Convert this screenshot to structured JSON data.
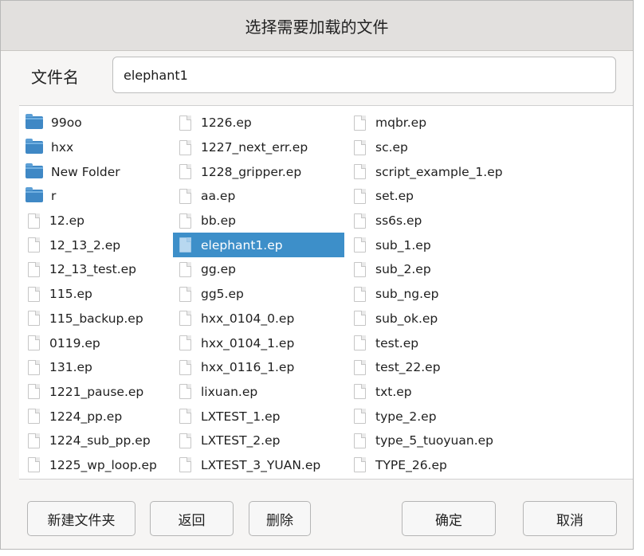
{
  "dialog": {
    "title": "选择需要加载的文件",
    "name_label": "文件名",
    "name_value": "elephant1"
  },
  "files": {
    "column1": [
      {
        "name": "99oo",
        "type": "folder"
      },
      {
        "name": "hxx",
        "type": "folder"
      },
      {
        "name": "New Folder",
        "type": "folder"
      },
      {
        "name": "r",
        "type": "folder"
      },
      {
        "name": "12.ep",
        "type": "file"
      },
      {
        "name": "12_13_2.ep",
        "type": "file"
      },
      {
        "name": "12_13_test.ep",
        "type": "file"
      },
      {
        "name": "115.ep",
        "type": "file"
      },
      {
        "name": "115_backup.ep",
        "type": "file"
      },
      {
        "name": "0119.ep",
        "type": "file"
      },
      {
        "name": "131.ep",
        "type": "file"
      },
      {
        "name": "1221_pause.ep",
        "type": "file"
      },
      {
        "name": "1224_pp.ep",
        "type": "file"
      },
      {
        "name": "1224_sub_pp.ep",
        "type": "file"
      },
      {
        "name": "1225_wp_loop.ep",
        "type": "file"
      }
    ],
    "column2": [
      {
        "name": "1226.ep",
        "type": "file"
      },
      {
        "name": "1227_next_err.ep",
        "type": "file"
      },
      {
        "name": "1228_gripper.ep",
        "type": "file"
      },
      {
        "name": "aa.ep",
        "type": "file"
      },
      {
        "name": "bb.ep",
        "type": "file"
      },
      {
        "name": "elephant1.ep",
        "type": "file",
        "selected": true
      },
      {
        "name": "gg.ep",
        "type": "file"
      },
      {
        "name": "gg5.ep",
        "type": "file"
      },
      {
        "name": "hxx_0104_0.ep",
        "type": "file"
      },
      {
        "name": "hxx_0104_1.ep",
        "type": "file"
      },
      {
        "name": "hxx_0116_1.ep",
        "type": "file"
      },
      {
        "name": "lixuan.ep",
        "type": "file"
      },
      {
        "name": "LXTEST_1.ep",
        "type": "file"
      },
      {
        "name": "LXTEST_2.ep",
        "type": "file"
      },
      {
        "name": "LXTEST_3_YUAN.ep",
        "type": "file"
      }
    ],
    "column3": [
      {
        "name": "mqbr.ep",
        "type": "file"
      },
      {
        "name": "sc.ep",
        "type": "file"
      },
      {
        "name": "script_example_1.ep",
        "type": "file"
      },
      {
        "name": "set.ep",
        "type": "file"
      },
      {
        "name": "ss6s.ep",
        "type": "file"
      },
      {
        "name": "sub_1.ep",
        "type": "file"
      },
      {
        "name": "sub_2.ep",
        "type": "file"
      },
      {
        "name": "sub_ng.ep",
        "type": "file"
      },
      {
        "name": "sub_ok.ep",
        "type": "file"
      },
      {
        "name": "test.ep",
        "type": "file"
      },
      {
        "name": "test_22.ep",
        "type": "file"
      },
      {
        "name": "txt.ep",
        "type": "file"
      },
      {
        "name": "type_2.ep",
        "type": "file"
      },
      {
        "name": "type_5_tuoyuan.ep",
        "type": "file"
      },
      {
        "name": "TYPE_26.ep",
        "type": "file"
      }
    ]
  },
  "buttons": {
    "new_folder": "新建文件夹",
    "back": "返回",
    "delete": "删除",
    "ok": "确定",
    "cancel": "取消"
  },
  "icons": {
    "folder": "folder-icon",
    "file": "file-icon"
  },
  "colors": {
    "selection": "#3d8fc9",
    "folder": "#3f88c5"
  }
}
